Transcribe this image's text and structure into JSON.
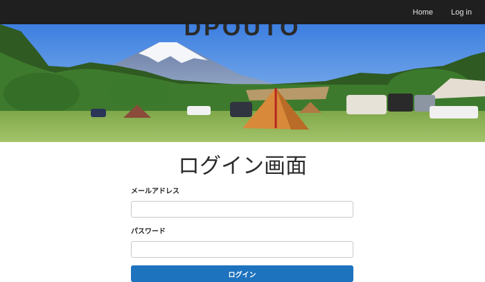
{
  "nav": {
    "home": "Home",
    "login": "Log in"
  },
  "hero": {
    "brand": "DPOUTO"
  },
  "page": {
    "title": "ログイン画面"
  },
  "form": {
    "email_label": "メールアドレス",
    "email_value": "",
    "password_label": "パスワード",
    "password_value": "",
    "submit_label": "ログイン"
  },
  "colors": {
    "nav_bg": "#1f1f1f",
    "primary": "#1e73be"
  }
}
